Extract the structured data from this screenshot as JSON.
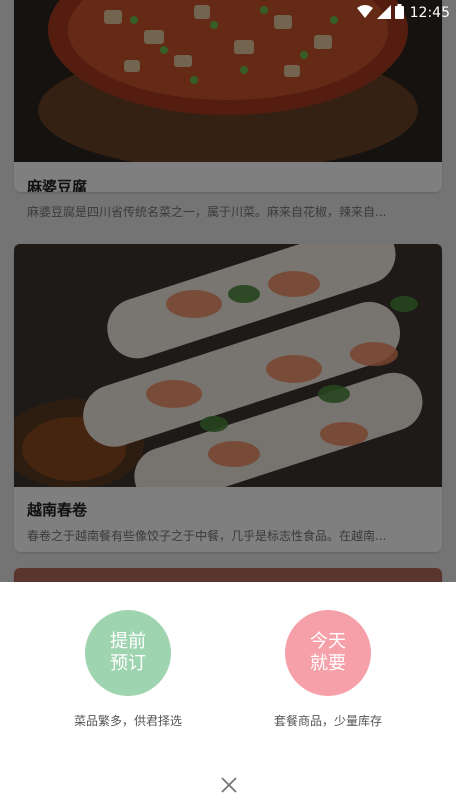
{
  "status_bar": {
    "time": "12:45"
  },
  "cards": [
    {
      "title": "麻婆豆腐",
      "description": "麻婆豆腐是四川省传统名菜之一，属于川菜。麻来自花椒，辣来自..."
    },
    {
      "title": "越南春卷",
      "description": "春卷之于越南餐有些像饺子之于中餐，几乎是标志性食品。在越南..."
    }
  ],
  "actions": [
    {
      "label": "提前预订",
      "caption": "菜品繁多，供君择选",
      "color": "#9fd4b1"
    },
    {
      "label": "今天就要",
      "caption": "套餐商品，少量库存",
      "color": "#f6a1a9"
    }
  ],
  "icons": {
    "close": "close-icon",
    "wifi": "wifi-icon",
    "signal": "signal-icon",
    "battery": "battery-icon"
  }
}
